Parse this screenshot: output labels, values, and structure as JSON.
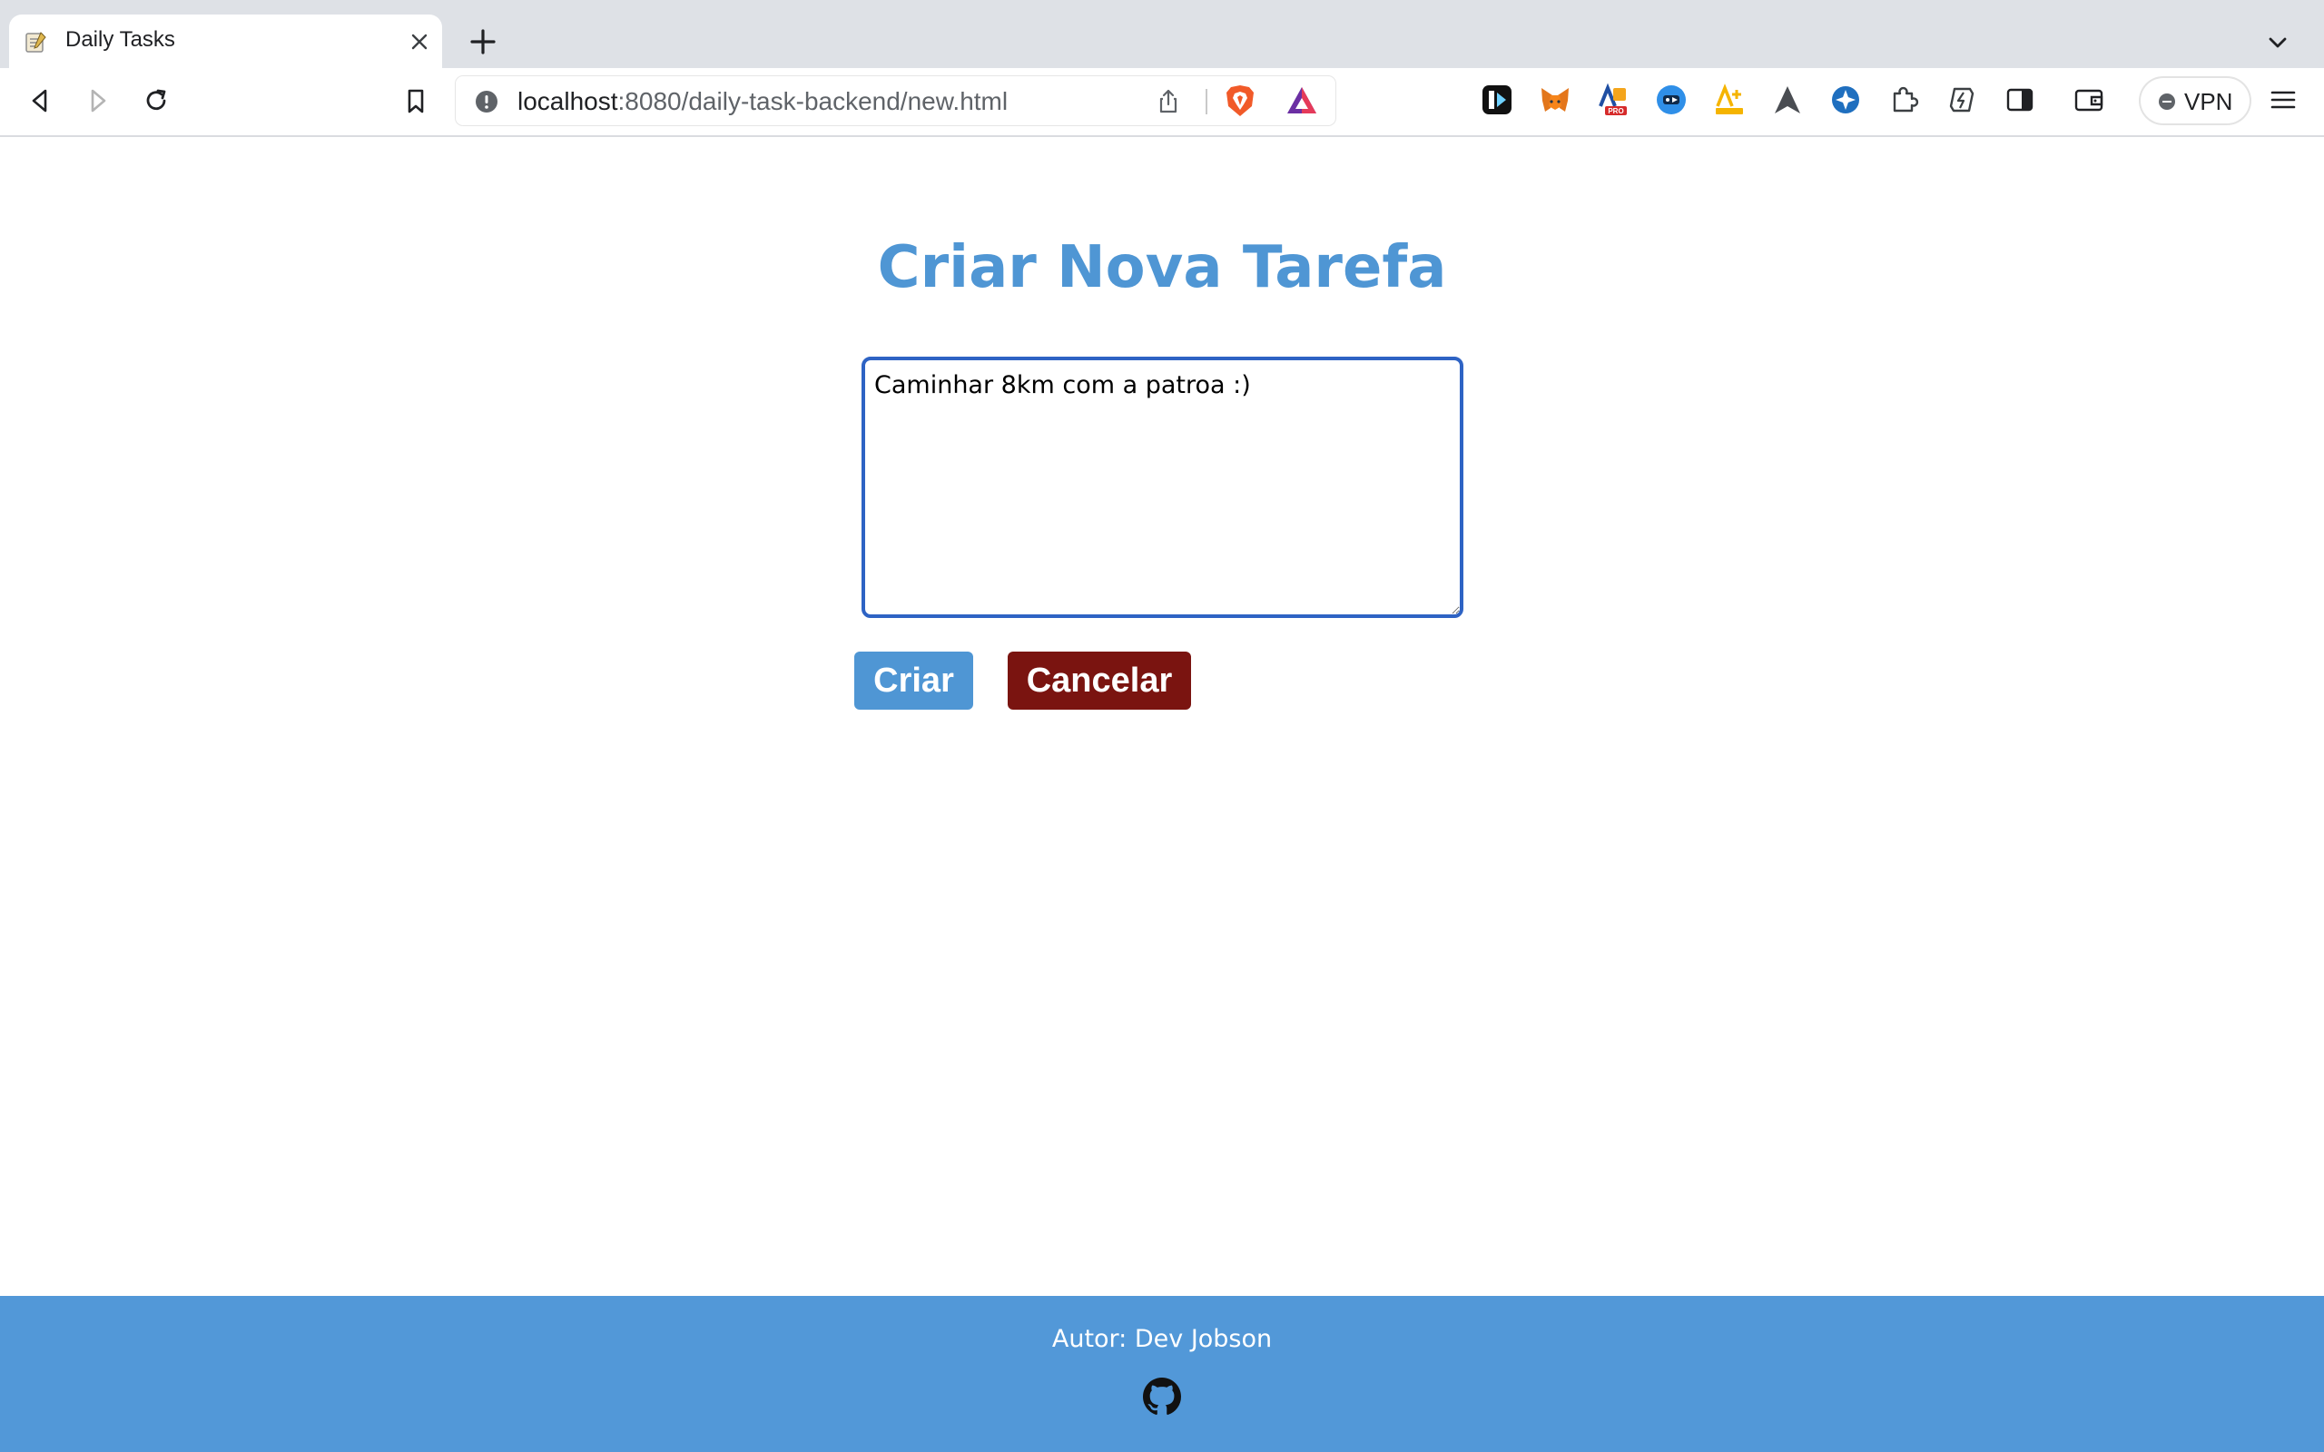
{
  "browser": {
    "tab": {
      "title": "Daily Tasks"
    },
    "address": {
      "host": "localhost",
      "rest": ":8080/daily-task-backend/new.html"
    },
    "vpn_label": "VPN"
  },
  "page": {
    "title": "Criar Nova Tarefa",
    "task_input": {
      "value": "Caminhar 8km com a patroa :)"
    },
    "buttons": {
      "create": "Criar",
      "cancel": "Cancelar"
    }
  },
  "footer": {
    "author": "Autor: Dev Jobson",
    "icon": "github-icon"
  },
  "colors": {
    "title": "#4f96d4",
    "create_button": "#4f96d4",
    "cancel_button": "#7a1410",
    "footer_bg": "#5298d8",
    "textarea_border": "#2e63c4"
  }
}
